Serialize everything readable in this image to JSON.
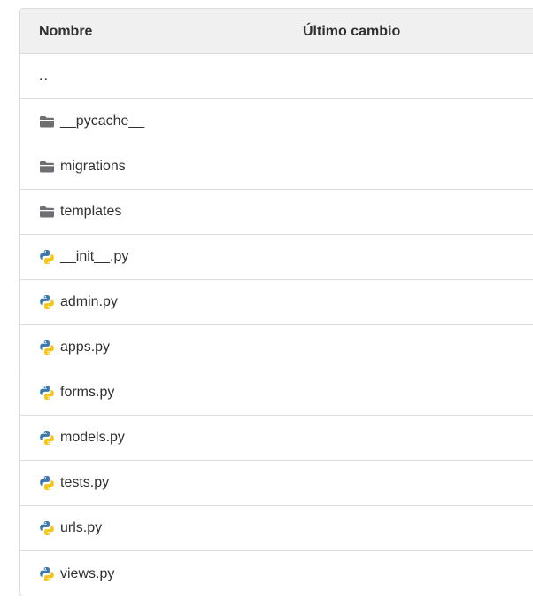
{
  "table": {
    "headers": {
      "name": "Nombre",
      "last_change": "Último cambio"
    },
    "parent": "..",
    "items": [
      {
        "name": "__pycache__",
        "icon": "folder-icon",
        "type": "folder"
      },
      {
        "name": "migrations",
        "icon": "folder-icon",
        "type": "folder"
      },
      {
        "name": "templates",
        "icon": "folder-icon",
        "type": "folder"
      },
      {
        "name": "__init__.py",
        "icon": "python-file-icon",
        "type": "file"
      },
      {
        "name": "admin.py",
        "icon": "python-file-icon",
        "type": "file"
      },
      {
        "name": "apps.py",
        "icon": "python-file-icon",
        "type": "file"
      },
      {
        "name": "forms.py",
        "icon": "python-file-icon",
        "type": "file"
      },
      {
        "name": "models.py",
        "icon": "python-file-icon",
        "type": "file"
      },
      {
        "name": "tests.py",
        "icon": "python-file-icon",
        "type": "file"
      },
      {
        "name": "urls.py",
        "icon": "python-file-icon",
        "type": "file"
      },
      {
        "name": "views.py",
        "icon": "python-file-icon",
        "type": "file"
      }
    ]
  },
  "colors": {
    "folder": "#6e6e73",
    "python_blue": "#3b77a8",
    "python_yellow": "#f5c518"
  }
}
